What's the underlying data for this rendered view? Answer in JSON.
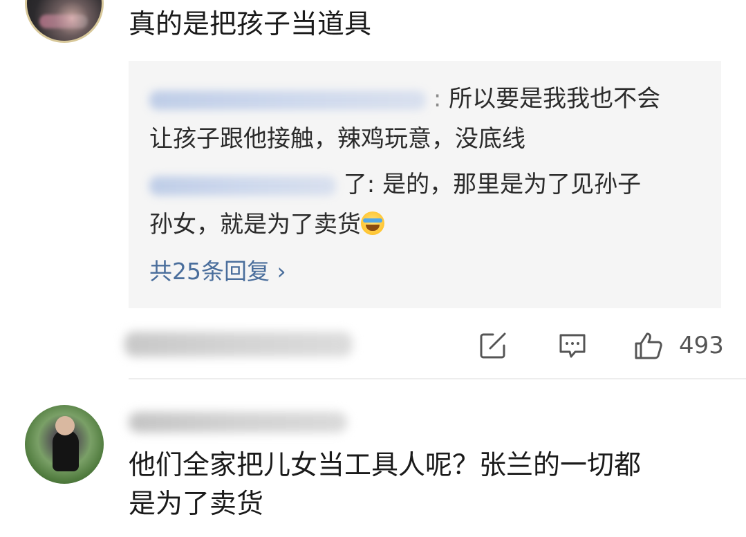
{
  "comment1": {
    "text": "真的是把孩子当道具"
  },
  "replies": {
    "reply1_line1": "所以要是我我也不会",
    "reply1_line2": "让孩子跟他接触，辣鸡玩意，没底线",
    "reply2_tail": "了: 是的，那里是为了见孙子",
    "reply2_line2": "孙女，就是为了卖货",
    "more": "共25条回复 ›"
  },
  "actions": {
    "like_count": "493",
    "share_icon": "edit-share-icon",
    "comment_icon": "comment-bubble-icon",
    "like_icon": "thumbs-up-icon"
  },
  "comment2": {
    "text_line1": "他们全家把儿女当工具人呢？张兰的一切都",
    "text_line2": "是为了卖货"
  },
  "colors": {
    "link": "#4a6e9c",
    "reply_bg": "#f5f5f5",
    "text": "#1a1a1a",
    "meta": "#555555"
  }
}
